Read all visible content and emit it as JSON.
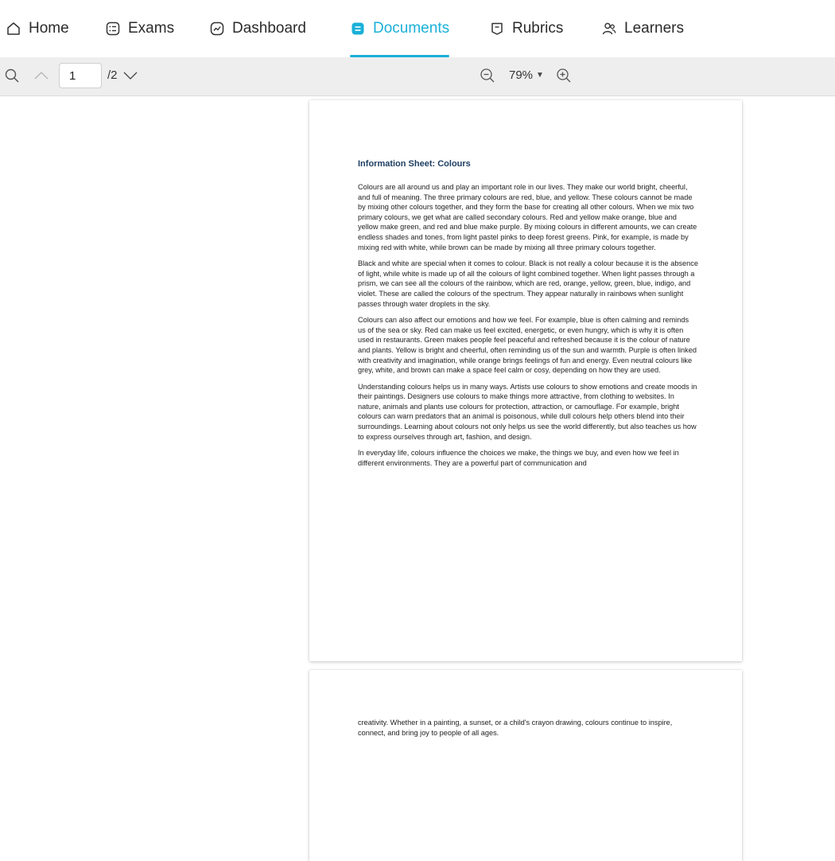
{
  "nav": {
    "tabs": [
      {
        "label": "Home",
        "icon": "home-icon",
        "active": false
      },
      {
        "label": "Exams",
        "icon": "exams-list-icon",
        "active": false
      },
      {
        "label": "Dashboard",
        "icon": "dashboard-chart-icon",
        "active": false
      },
      {
        "label": "Documents",
        "icon": "document-icon",
        "active": true
      },
      {
        "label": "Rubrics",
        "icon": "rubric-icon",
        "active": false
      },
      {
        "label": "Learners",
        "icon": "learners-icon",
        "active": false
      }
    ],
    "accent_color": "#1ab0d8"
  },
  "toolbar": {
    "search_icon": "search-icon",
    "prev_icon": "chevron-up-icon",
    "next_icon": "chevron-down-icon",
    "current_page": "1",
    "total_pages": "/2",
    "zoom_out_icon": "zoom-out-icon",
    "zoom_level": "79%",
    "zoom_in_icon": "zoom-in-icon"
  },
  "document": {
    "title": "Information Sheet: Colours",
    "title_color": "#1f3f63",
    "page1_paragraphs": [
      "Colours are all around us and play an important role in our lives. They make our world bright, cheerful, and full of meaning. The three primary colours are red, blue, and yellow. These colours cannot be made by mixing other colours together, and they form the base for creating all other colours. When we mix two primary colours, we get what are called secondary colours. Red and yellow make orange, blue and yellow make green, and red and blue make purple. By mixing colours in different amounts, we can create endless shades and tones, from light pastel pinks to deep forest greens. Pink, for example, is made by mixing red with white, while brown can be made by mixing all three primary colours together.",
      "Black and white are special when it comes to colour. Black is not really a colour because it is the absence of light, while white is made up of all the colours of light combined together. When light passes through a prism, we can see all the colours of the rainbow, which are red, orange, yellow, green, blue, indigo, and violet. These are called the colours of the spectrum. They appear naturally in rainbows when sunlight passes through water droplets in the sky.",
      "Colours can also affect our emotions and how we feel. For example, blue is often calming and reminds us of the sea or sky. Red can make us feel excited, energetic, or even hungry, which is why it is often used in restaurants. Green makes people feel peaceful and refreshed because it is the colour of nature and plants. Yellow is bright and cheerful, often reminding us of the sun and warmth. Purple is often linked with creativity and imagination, while orange brings feelings of fun and energy. Even neutral colours like grey, white, and brown can make a space feel calm or cosy, depending on how they are used.",
      "Understanding colours helps us in many ways. Artists use colours to show emotions and create moods in their paintings. Designers use colours to make things more attractive, from clothing to websites. In nature, animals and plants use colours for protection, attraction, or camouflage. For example, bright colours can warn predators that an animal is poisonous, while dull colours help others blend into their surroundings. Learning about colours not only helps us see the world differently, but also teaches us how to express ourselves through art, fashion, and design.",
      "In everyday life, colours influence the choices we make, the things we buy, and even how we feel in different environments. They are a powerful part of communication and"
    ],
    "page2_paragraphs": [
      "creativity. Whether in a painting, a sunset, or a child's crayon drawing, colours continue to inspire, connect, and bring joy to people of all ages."
    ]
  }
}
